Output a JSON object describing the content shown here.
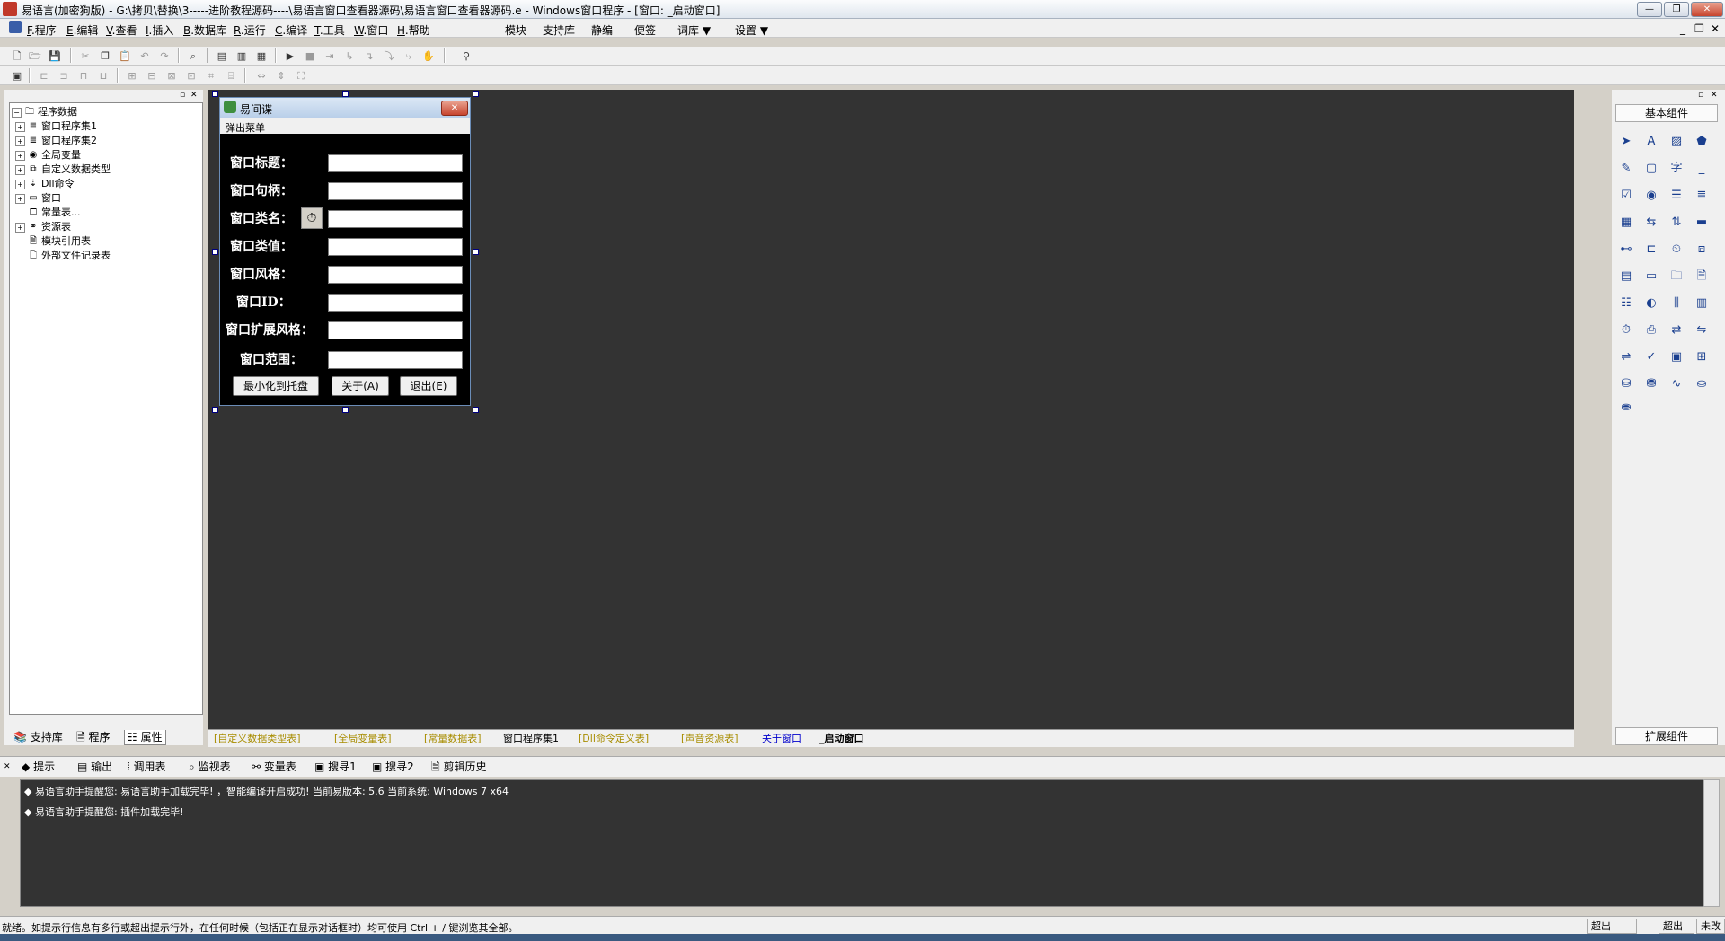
{
  "window": {
    "title": "易语言(加密狗版) - G:\\拷贝\\替换\\3-----进阶教程源码----\\易语言窗口查看器源码\\易语言窗口查看器源码.e - Windows窗口程序 - [窗口: _启动窗口]",
    "min": "—",
    "max": "❐",
    "close": "✕"
  },
  "menu": {
    "items": [
      {
        "key": "F",
        "label": ".程序"
      },
      {
        "key": "E",
        "label": ".编辑"
      },
      {
        "key": "V",
        "label": ".查看"
      },
      {
        "key": "I",
        "label": ".插入"
      },
      {
        "key": "B",
        "label": ".数据库"
      },
      {
        "key": "R",
        "label": ".运行"
      },
      {
        "key": "C",
        "label": ".编译"
      },
      {
        "key": "T",
        "label": ".工具"
      },
      {
        "key": "W",
        "label": ".窗口"
      },
      {
        "key": "H",
        "label": ".帮助"
      }
    ],
    "extra": [
      "模块",
      "支持库",
      "静编",
      "便签",
      "词库 ▼",
      "设置 ▼"
    ],
    "right_controls": [
      "_",
      "❐",
      "✕"
    ]
  },
  "left_panel": {
    "tree": [
      {
        "label": "程序数据",
        "icon": "root",
        "level": 0
      },
      {
        "label": "窗口程序集1",
        "icon": "module",
        "level": 1
      },
      {
        "label": "窗口程序集2",
        "icon": "module",
        "level": 1
      },
      {
        "label": "全局变量",
        "icon": "var",
        "level": 1
      },
      {
        "label": "自定义数据类型",
        "icon": "type",
        "level": 1
      },
      {
        "label": "Dll命令",
        "icon": "dll",
        "level": 1
      },
      {
        "label": "窗口",
        "icon": "window",
        "level": 1
      },
      {
        "label": "常量表...",
        "icon": "const",
        "level": 1
      },
      {
        "label": "资源表",
        "icon": "res",
        "level": 1
      },
      {
        "label": "模块引用表",
        "icon": "ref",
        "level": 1
      },
      {
        "label": "外部文件记录表",
        "icon": "file",
        "level": 1
      }
    ],
    "tabs": [
      "支持库",
      "程序",
      "属性"
    ]
  },
  "form": {
    "title": "易间谍",
    "menu": "弹出菜单",
    "fields": [
      {
        "label": "窗口标题：",
        "value": ""
      },
      {
        "label": "窗口句柄：",
        "value": ""
      },
      {
        "label": "窗口类名：",
        "value": ""
      },
      {
        "label": "窗口类值：",
        "value": ""
      },
      {
        "label": "窗口风格：",
        "value": ""
      },
      {
        "label": "窗口ID：",
        "value": ""
      },
      {
        "label": "窗口扩展风格：",
        "value": ""
      },
      {
        "label": "窗口范围：",
        "value": ""
      }
    ],
    "buttons": [
      "最小化到托盘",
      "关于(A)",
      "退出(E)"
    ]
  },
  "design_tabs": [
    {
      "label": "[自定义数据类型表]",
      "style": "yellow"
    },
    {
      "label": "[全局变量表]",
      "style": "yellow"
    },
    {
      "label": "[常量数据表]",
      "style": "yellow"
    },
    {
      "label": "窗口程序集1",
      "style": "normal"
    },
    {
      "label": "[Dll命令定义表]",
      "style": "yellow"
    },
    {
      "label": "[声音资源表]",
      "style": "yellow"
    },
    {
      "label": "关于窗口",
      "style": "blue"
    },
    {
      "label": "_启动窗口",
      "style": "active"
    }
  ],
  "right_panel": {
    "title": "基本组件",
    "footer": "扩展组件"
  },
  "output_tabs": [
    "提示",
    "输出",
    "调用表",
    "监视表",
    "变量表",
    "搜寻1",
    "搜寻2",
    "剪辑历史"
  ],
  "output_lines": [
    "◆ 易语言助手提醒您: 易语言助手加载完毕! ，智能编译开启成功! 当前易版本: 5.6 当前系统: Windows 7 x64",
    "◆ 易语言助手提醒您: 插件加载完毕!"
  ],
  "status": {
    "text": "就绪。如提示行信息有多行或超出提示行外，在任何时候（包括正在显示对话框时）均可使用 Ctrl + / 键浏览其全部。",
    "box1": "超出",
    "box2": "超出",
    "box3": "未改"
  }
}
